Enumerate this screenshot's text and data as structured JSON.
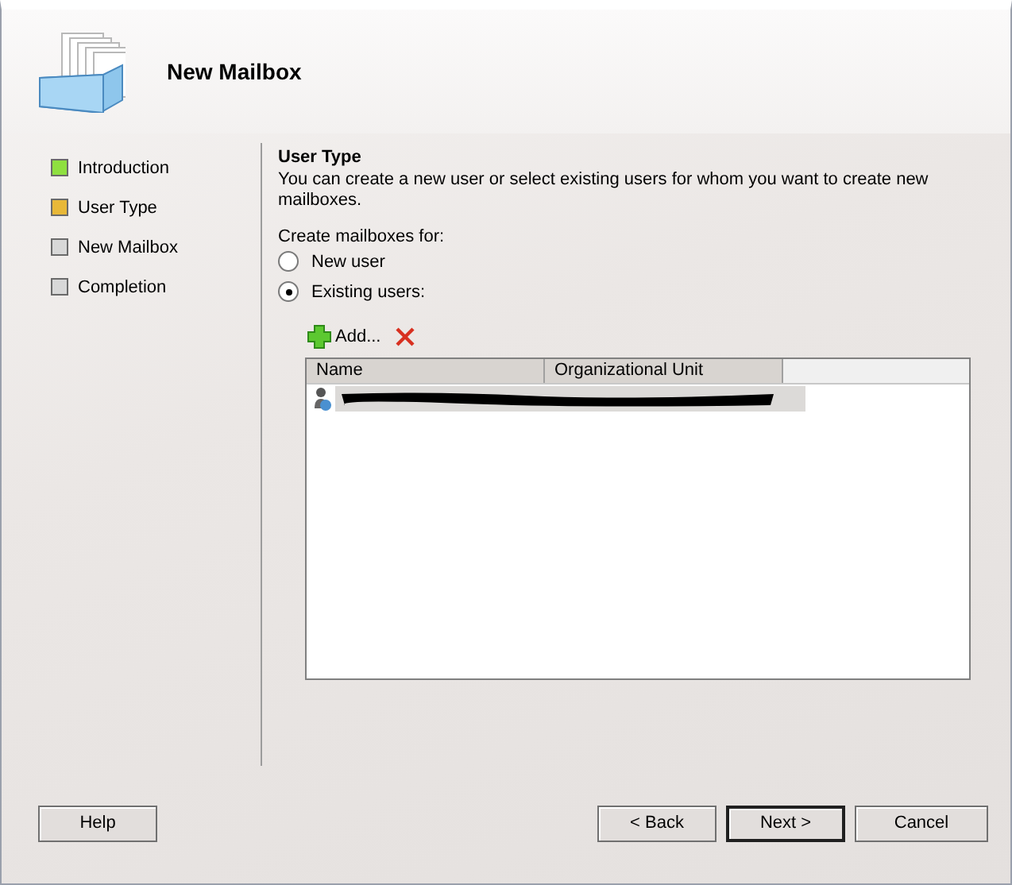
{
  "header": {
    "title": "New Mailbox"
  },
  "steps": [
    {
      "label": "Introduction",
      "color": "#8fe040"
    },
    {
      "label": "User Type",
      "color": "#e8b838"
    },
    {
      "label": "New Mailbox",
      "color": "#d8d8d8"
    },
    {
      "label": "Completion",
      "color": "#d8d8d8"
    }
  ],
  "page": {
    "heading": "User Type",
    "description": "You can create a new user or select existing users for whom you want to create new mailboxes.",
    "group_label": "Create mailboxes for:",
    "options": [
      {
        "label": "New user",
        "selected": false
      },
      {
        "label": "Existing users:",
        "selected": true
      }
    ],
    "toolbar": {
      "add_label": "Add..."
    },
    "table": {
      "columns": [
        "Name",
        "Organizational Unit"
      ],
      "rows": [
        {
          "selected": true
        }
      ]
    }
  },
  "buttons": [
    {
      "label": "Help",
      "kind": "help",
      "default": false
    },
    {
      "label": "< Back",
      "kind": "nav",
      "default": false
    },
    {
      "label": "Next >",
      "kind": "nav",
      "default": true
    },
    {
      "label": "Cancel",
      "kind": "cancel",
      "default": false
    }
  ]
}
